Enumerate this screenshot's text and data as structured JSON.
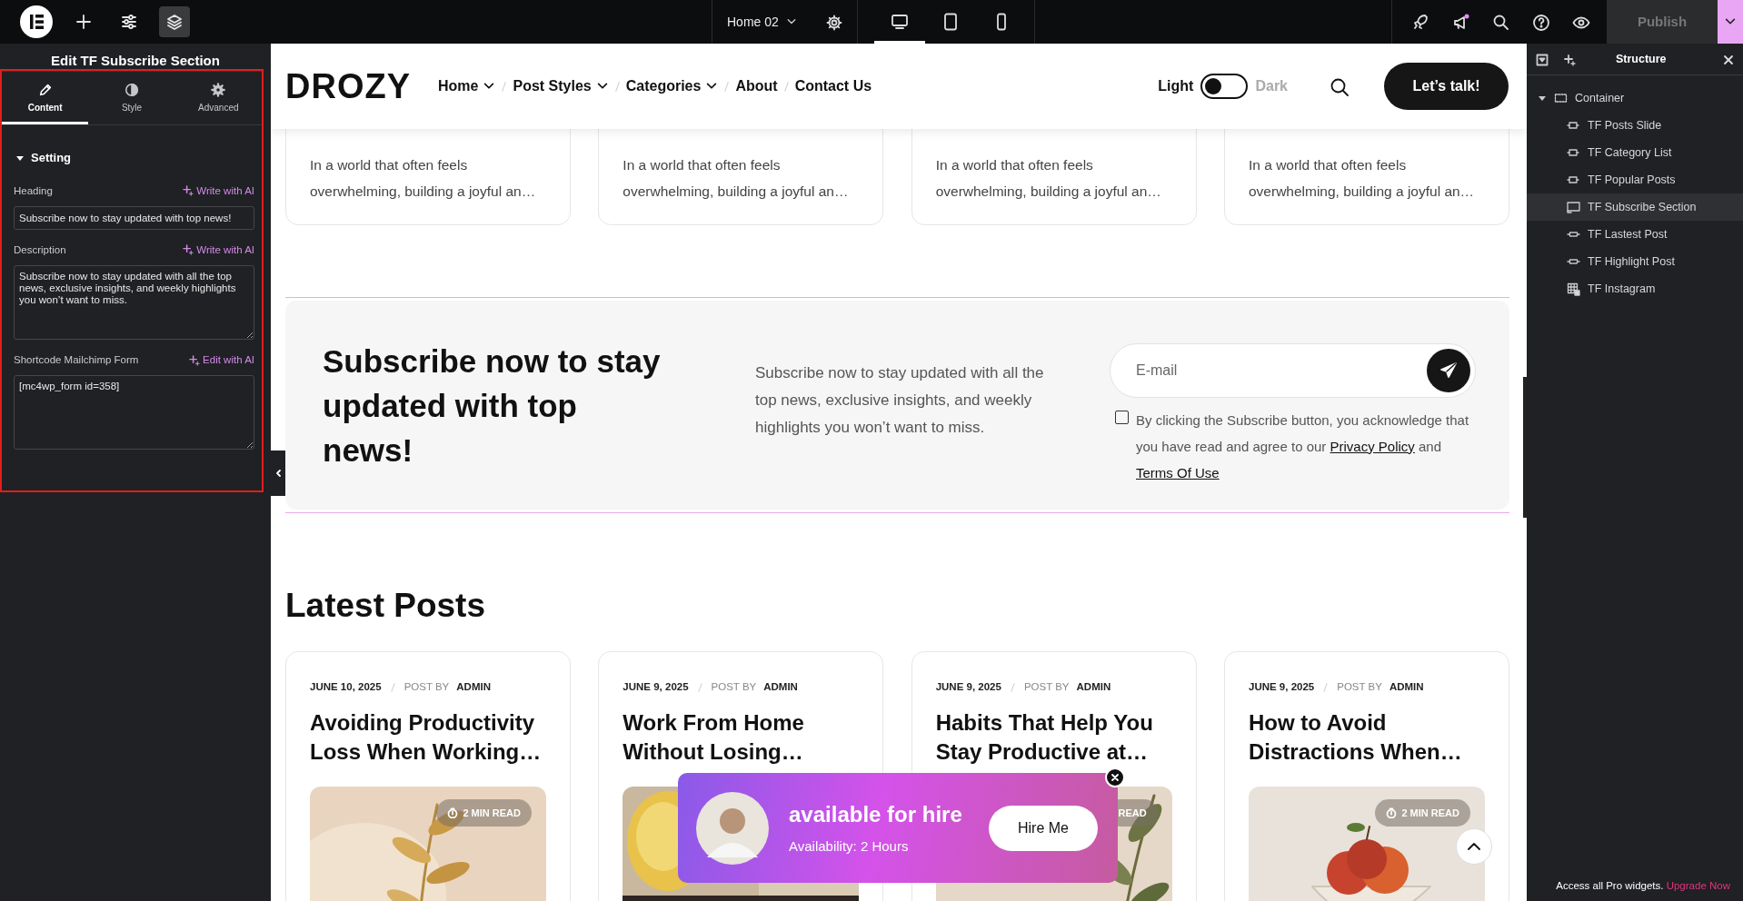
{
  "left_tools": [
    {
      "kind": "logo",
      "selected": false
    },
    {
      "kind": "add",
      "selected": false
    },
    {
      "kind": "settings",
      "selected": false
    },
    {
      "kind": "layers",
      "selected": true
    }
  ],
  "toolbar": {
    "page": "Home 02",
    "devices": [
      {
        "kind": "desktop",
        "selected": true
      },
      {
        "kind": "tablet",
        "selected": false
      },
      {
        "kind": "mobile",
        "selected": false
      }
    ],
    "publish": "Publish"
  },
  "panel": {
    "title": "Edit TF Subscribe Section",
    "tabs": [
      {
        "label": "Content",
        "kind": "pencil",
        "selected": true
      },
      {
        "label": "Style",
        "kind": "contrast",
        "selected": false
      },
      {
        "label": "Advanced",
        "kind": "gear",
        "selected": false
      }
    ],
    "section": {
      "title": "Setting",
      "expanded": true
    },
    "fields": [
      {
        "label": "Heading",
        "action": "Write with AI",
        "kind": "input",
        "value": "Subscribe now to stay updated with top news!"
      },
      {
        "label": "Description",
        "action": "Write with AI",
        "kind": "textarea",
        "value": "Subscribe now to stay updated with all the top news, exclusive insights, and weekly highlights you won’t want to miss."
      },
      {
        "label": "Shortcode Mailchimp Form",
        "action": "Edit with AI",
        "kind": "textarea",
        "value": "[mc4wp_form id=358]"
      }
    ]
  },
  "site": {
    "logo": "DROZY",
    "nav": [
      {
        "label": "Home",
        "has_menu": true
      },
      {
        "label": "Post Styles",
        "has_menu": true
      },
      {
        "label": "Categories",
        "has_menu": true
      },
      {
        "label": "About",
        "has_menu": false
      },
      {
        "label": "Contact Us",
        "has_menu": false
      }
    ],
    "theme": {
      "light": "Light",
      "dark": "Dark",
      "on": false
    },
    "cta": "Let’s talk!"
  },
  "top_cards": [
    {
      "excerpt": "In a world that often feels overwhelming, building a joyful an…"
    },
    {
      "excerpt": "In a world that often feels overwhelming, building a joyful an…"
    },
    {
      "excerpt": "In a world that often feels overwhelming, building a joyful an…"
    },
    {
      "excerpt": "In a world that often feels overwhelming, building a joyful an…"
    }
  ],
  "subscribe": {
    "heading": "Subscribe now to stay updated with top news!",
    "description": "Subscribe now to stay updated with all the top news, exclusive insights, and weekly highlights you won’t want to miss.",
    "email_placeholder": "E-mail",
    "consent": {
      "checked": false,
      "text": "By clicking the Subscribe button, you acknowledge that you have read and agree to our",
      "link_1": "Privacy Policy",
      "joiner": "and",
      "link_2": "Terms Of Use"
    }
  },
  "latest": {
    "title": "Latest Posts",
    "posts": [
      {
        "date": "JUNE 10, 2025",
        "by_label": "POST BY",
        "author": "ADMIN",
        "title": "Avoiding Productivity Loss When Working…",
        "read_time": "2 MIN READ",
        "timer_icon": true,
        "kind": "picture"
      },
      {
        "date": "JUNE 9, 2025",
        "by_label": "POST BY",
        "author": "ADMIN",
        "title": "Work From Home Without Losing…",
        "kind": "picture"
      },
      {
        "date": "JUNE 9, 2025",
        "by_label": "POST BY",
        "author": "ADMIN",
        "title": "Habits That Help You Stay Productive at…",
        "read_time": "READ",
        "timer_icon": false,
        "kind": "picture"
      },
      {
        "date": "JUNE 9, 2025",
        "by_label": "POST BY",
        "author": "ADMIN",
        "title": "How to Avoid Distractions When…",
        "read_time": "2 MIN READ",
        "timer_icon": true,
        "kind": "picture"
      }
    ]
  },
  "hire_popup": {
    "title": "available for hire",
    "availability": "Availability: 2 Hours",
    "button": "Hire Me"
  },
  "structure": {
    "title": "Structure",
    "tree": [
      {
        "label": "Container",
        "kind": "container",
        "expanded": true,
        "children": [
          {
            "label": "TF Posts Slide",
            "kind": "slide",
            "selected": false
          },
          {
            "label": "TF Category List",
            "kind": "slide",
            "selected": false
          },
          {
            "label": "TF Popular Posts",
            "kind": "slide",
            "selected": false
          },
          {
            "label": "TF Subscribe Section",
            "kind": "banner",
            "selected": true
          },
          {
            "label": "TF Lastest Post",
            "kind": "carousel",
            "selected": false
          },
          {
            "label": "TF Highlight Post",
            "kind": "carousel",
            "selected": false
          },
          {
            "label": "TF Instagram",
            "kind": "gallery",
            "selected": false
          }
        ]
      }
    ]
  },
  "promo": {
    "text": "Access all Pro widgets.",
    "link": "Upgrade Now"
  }
}
